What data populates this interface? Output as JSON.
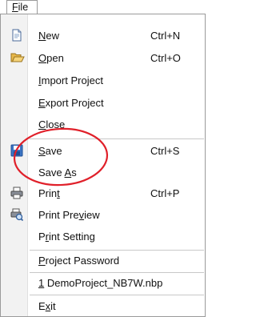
{
  "menubar": {
    "file_label": "File"
  },
  "menu": {
    "items": [
      {
        "id": "new",
        "pre": "",
        "acc": "N",
        "post": "ew",
        "shortcut": "Ctrl+N",
        "icon": "new-document-icon"
      },
      {
        "id": "open",
        "pre": "",
        "acc": "O",
        "post": "pen",
        "shortcut": "Ctrl+O",
        "icon": "open-folder-icon"
      },
      {
        "id": "import-project",
        "pre": "",
        "acc": "I",
        "post": "mport Project",
        "shortcut": "",
        "icon": ""
      },
      {
        "id": "export-project",
        "pre": "",
        "acc": "E",
        "post": "xport Project",
        "shortcut": "",
        "icon": ""
      },
      {
        "id": "close",
        "pre": "",
        "acc": "C",
        "post": "lose",
        "shortcut": "",
        "icon": ""
      },
      {
        "id": "save",
        "pre": "",
        "acc": "S",
        "post": "ave",
        "shortcut": "Ctrl+S",
        "icon": "save-disk-icon"
      },
      {
        "id": "save-as",
        "pre": "Save ",
        "acc": "A",
        "post": "s",
        "shortcut": "",
        "icon": ""
      },
      {
        "id": "print",
        "pre": "Prin",
        "acc": "t",
        "post": "",
        "shortcut": "Ctrl+P",
        "icon": "printer-icon"
      },
      {
        "id": "print-preview",
        "pre": "Print Pre",
        "acc": "v",
        "post": "iew",
        "shortcut": "",
        "icon": "print-preview-icon"
      },
      {
        "id": "print-setting",
        "pre": "P",
        "acc": "r",
        "post": "int Setting",
        "shortcut": "",
        "icon": ""
      },
      {
        "id": "project-password",
        "pre": "",
        "acc": "P",
        "post": "roject Password",
        "shortcut": "",
        "icon": ""
      },
      {
        "id": "recent-1",
        "pre": "",
        "acc": "1",
        "post": " DemoProject_NB7W.nbp",
        "shortcut": "",
        "icon": ""
      },
      {
        "id": "exit",
        "pre": "E",
        "acc": "x",
        "post": "it",
        "shortcut": "",
        "icon": ""
      }
    ]
  },
  "colors": {
    "annotation_circle": "#e0202a",
    "gutter": "#f2f2f2",
    "border": "#9a9a9a"
  }
}
